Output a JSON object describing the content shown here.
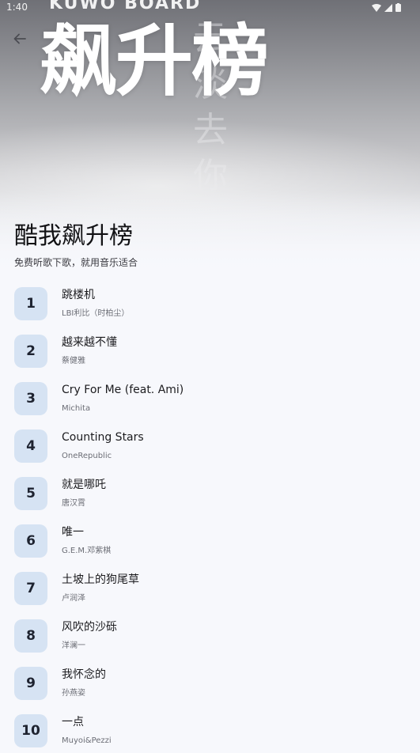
{
  "status_bar": {
    "time": "1:40"
  },
  "hero": {
    "top_text": "KUWO BOARD",
    "logo_text": "飙升榜",
    "ghost_chars": [
      "云",
      "淡",
      "去",
      "你"
    ]
  },
  "header": {
    "back_icon": "arrow-left-icon",
    "title": "酷我飙升榜",
    "subtitle": "免费听歌下歌，就用音乐适合"
  },
  "colors": {
    "rank_badge_bg": "#d6e3f3",
    "page_bg": "#f7f8fc",
    "title_text": "#111114",
    "secondary_text": "#6b6d75"
  },
  "songs": [
    {
      "rank": "1",
      "title": "跳楼机",
      "artist": "LBI利比（时柏尘）"
    },
    {
      "rank": "2",
      "title": "越来越不懂",
      "artist": "蔡健雅"
    },
    {
      "rank": "3",
      "title": "Cry For Me (feat. Ami)",
      "artist": "Michita"
    },
    {
      "rank": "4",
      "title": "Counting Stars",
      "artist": "OneRepublic"
    },
    {
      "rank": "5",
      "title": "就是哪吒",
      "artist": "唐汉霄"
    },
    {
      "rank": "6",
      "title": "唯一",
      "artist": "G.E.M.邓紫棋"
    },
    {
      "rank": "7",
      "title": "土坡上的狗尾草",
      "artist": "卢润泽"
    },
    {
      "rank": "8",
      "title": "风吹的沙砾",
      "artist": "洋澜一"
    },
    {
      "rank": "9",
      "title": "我怀念的",
      "artist": "孙燕姿"
    },
    {
      "rank": "10",
      "title": "一点",
      "artist": "Muyoi&Pezzi"
    }
  ]
}
